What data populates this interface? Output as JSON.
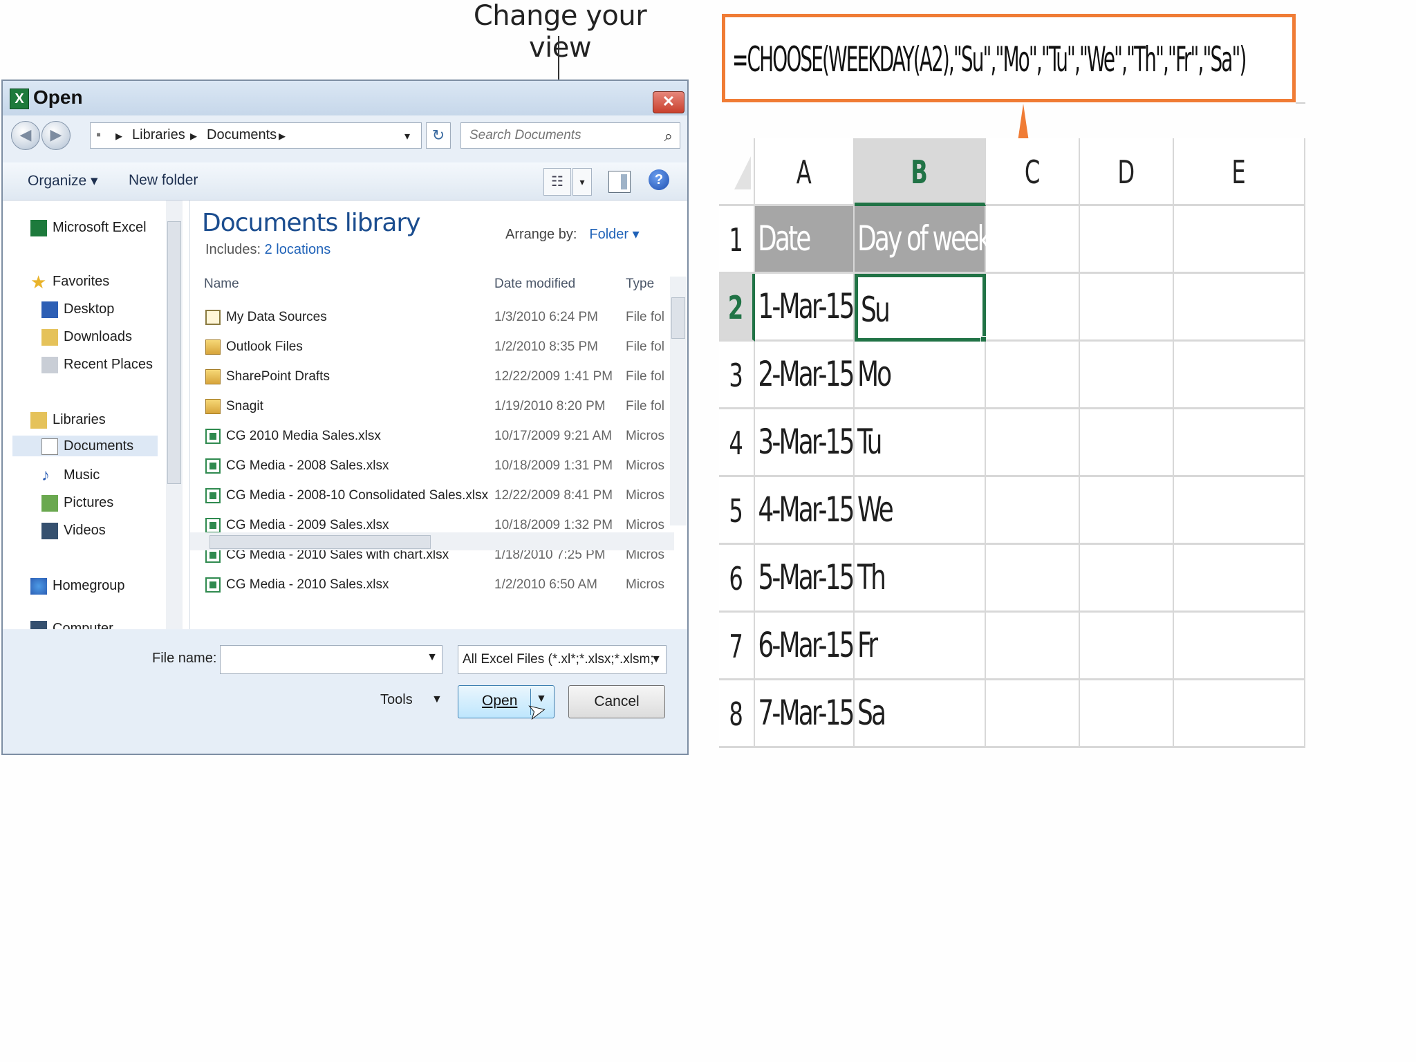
{
  "callout": {
    "text": "Change your view"
  },
  "dialog": {
    "title": "Open",
    "close_glyph": "✕",
    "address": {
      "root_glyph": "▪",
      "crumbs": [
        "Libraries",
        "Documents"
      ],
      "dropdown_glyph": "▾",
      "refresh_glyph": "↻"
    },
    "search": {
      "placeholder": "Search Documents",
      "icon_glyph": "⌕"
    },
    "toolbar": {
      "organize": "Organize ▾",
      "new_folder": "New folder",
      "view_glyph": "☷",
      "view_dd_glyph": "▾",
      "help_glyph": "?"
    },
    "nav": {
      "items": [
        "Microsoft Excel",
        "Favorites",
        "Desktop",
        "Downloads",
        "Recent Places",
        "Libraries",
        "Documents",
        "Music",
        "Pictures",
        "Videos",
        "Homegroup",
        "Computer"
      ]
    },
    "library": {
      "title": "Documents library",
      "includes_label": "Includes:",
      "includes_link": "2 locations",
      "arrange_label": "Arrange by:",
      "arrange_value": "Folder ▾"
    },
    "columns": {
      "name": "Name",
      "date": "Date modified",
      "type": "Type"
    },
    "files": [
      {
        "name": "My Data Sources",
        "date": "1/3/2010 6:24 PM",
        "type": "File fol",
        "icon": "data-source"
      },
      {
        "name": "Outlook Files",
        "date": "1/2/2010 8:35 PM",
        "type": "File fol",
        "icon": "folder"
      },
      {
        "name": "SharePoint Drafts",
        "date": "12/22/2009 1:41 PM",
        "type": "File fol",
        "icon": "folder"
      },
      {
        "name": "Snagit",
        "date": "1/19/2010 8:20 PM",
        "type": "File fol",
        "icon": "folder"
      },
      {
        "name": "CG 2010 Media Sales.xlsx",
        "date": "10/17/2009 9:21 AM",
        "type": "Micros",
        "icon": "excel"
      },
      {
        "name": "CG Media - 2008 Sales.xlsx",
        "date": "10/18/2009 1:31 PM",
        "type": "Micros",
        "icon": "excel"
      },
      {
        "name": "CG Media - 2008-10 Consolidated Sales.xlsx",
        "date": "12/22/2009 8:41 PM",
        "type": "Micros",
        "icon": "excel"
      },
      {
        "name": "CG Media - 2009 Sales.xlsx",
        "date": "10/18/2009 1:32 PM",
        "type": "Micros",
        "icon": "excel"
      },
      {
        "name": "CG Media - 2010 Sales with chart.xlsx",
        "date": "1/18/2010 7:25 PM",
        "type": "Micros",
        "icon": "excel"
      },
      {
        "name": "CG Media - 2010 Sales.xlsx",
        "date": "1/2/2010 6:50 AM",
        "type": "Micros",
        "icon": "excel"
      }
    ],
    "file_name_label": "File name:",
    "file_name_value": "",
    "file_type_filter": "All Excel Files (*.xl*;*.xlsx;*.xlsm;",
    "tools_label": "Tools",
    "open_label": "Open",
    "cancel_label": "Cancel"
  },
  "formula": "=CHOOSE(WEEKDAY(A2),\"Su\",\"Mo\",\"Tu\",\"We\",\"Th\",\"Fr\",\"Sa\")",
  "sheet": {
    "columns": [
      "A",
      "B",
      "C",
      "D",
      "E"
    ],
    "selected_column": "B",
    "selected_row": 2,
    "rows": [
      {
        "num": "1",
        "a": "Date",
        "b": "Day of week"
      },
      {
        "num": "2",
        "a": "1-Mar-15",
        "b": "Su"
      },
      {
        "num": "3",
        "a": "2-Mar-15",
        "b": "Mo"
      },
      {
        "num": "4",
        "a": "3-Mar-15",
        "b": "Tu"
      },
      {
        "num": "5",
        "a": "4-Mar-15",
        "b": "We"
      },
      {
        "num": "6",
        "a": "5-Mar-15",
        "b": "Th"
      },
      {
        "num": "7",
        "a": "6-Mar-15",
        "b": "Fr"
      },
      {
        "num": "8",
        "a": "7-Mar-15",
        "b": "Sa"
      }
    ]
  },
  "colors": {
    "accent_orange": "#f07c35",
    "excel_green": "#217346",
    "header_gray": "#a6a6a6"
  }
}
